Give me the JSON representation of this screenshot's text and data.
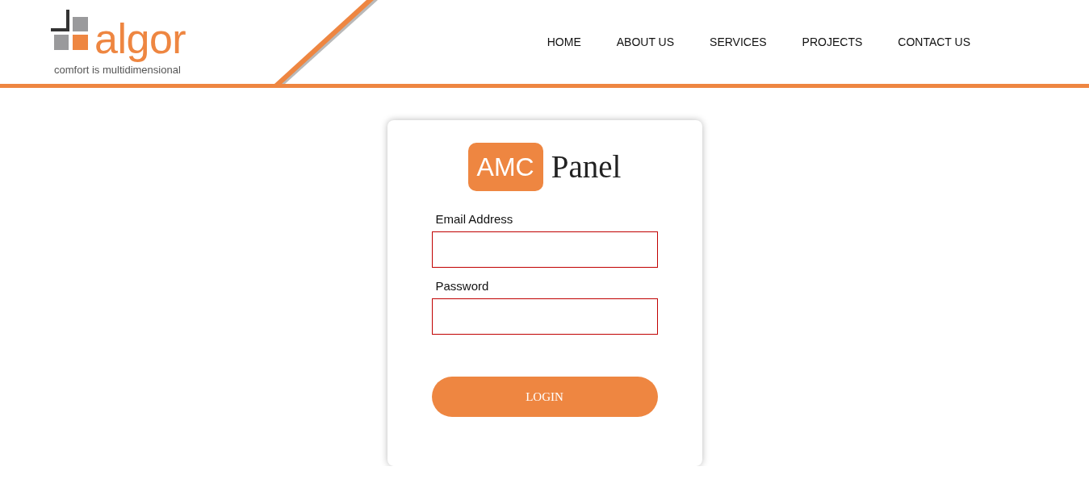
{
  "header": {
    "logo": {
      "wordmark": "algor",
      "tagline": "comfort is multidimensional"
    },
    "nav": [
      {
        "label": "HOME"
      },
      {
        "label": "ABOUT US"
      },
      {
        "label": "SERVICES"
      },
      {
        "label": "PROJECTS"
      },
      {
        "label": "CONTACT US"
      }
    ]
  },
  "login_card": {
    "badge": "AMC",
    "title": "Panel",
    "fields": [
      {
        "label": "Email Address",
        "invalid": true
      },
      {
        "label": "Password",
        "invalid": true
      }
    ],
    "button": "LOGIN"
  }
}
